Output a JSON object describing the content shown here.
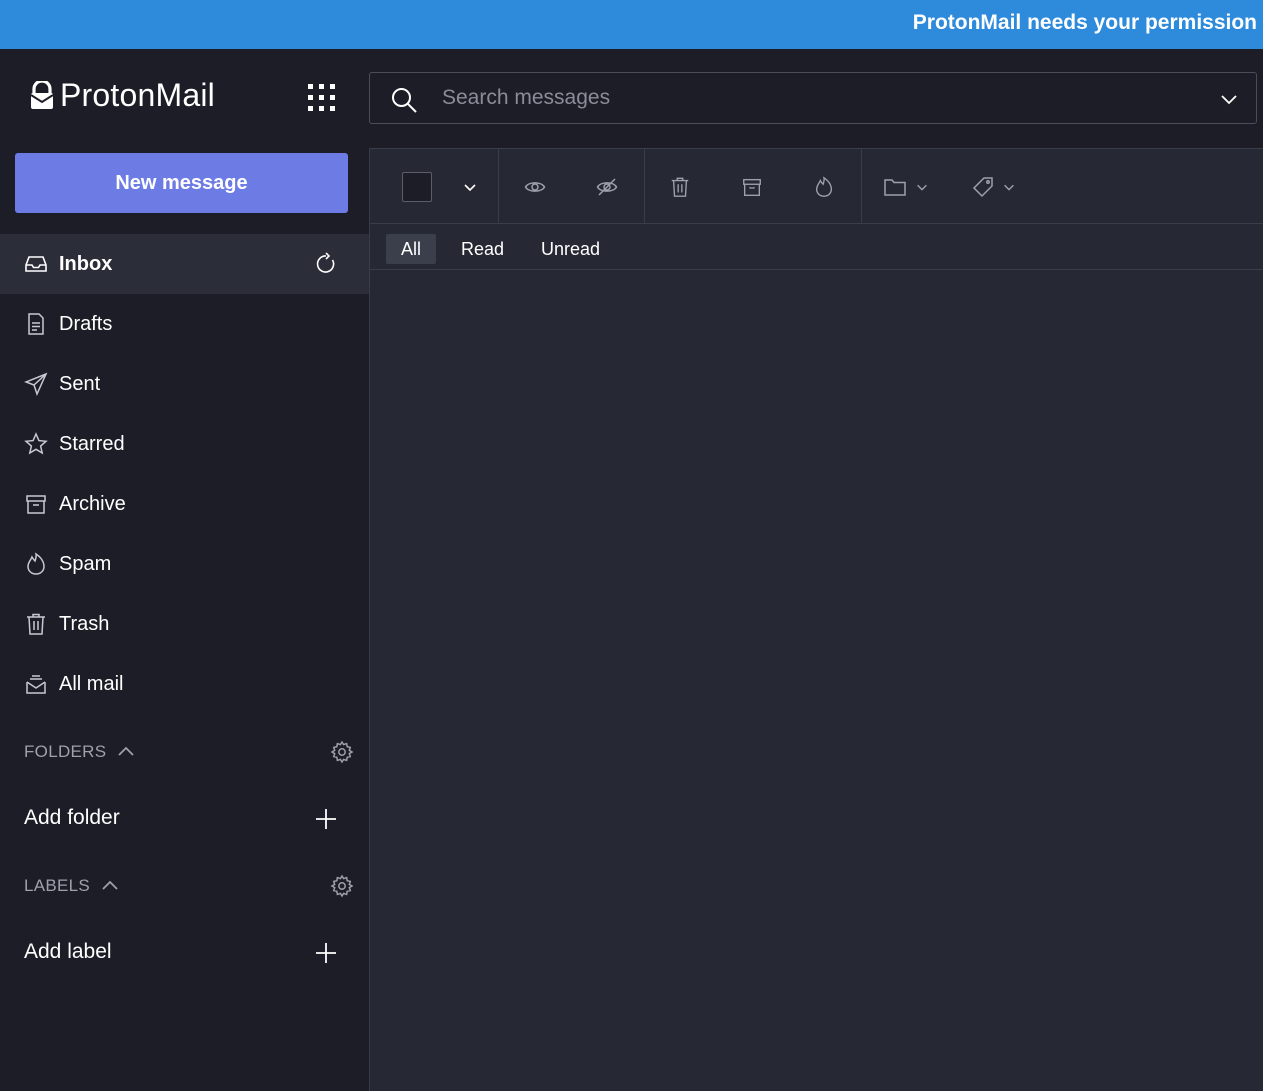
{
  "banner": {
    "text": "ProtonMail needs your permission"
  },
  "app": {
    "name": "ProtonMail"
  },
  "compose": {
    "label": "New message"
  },
  "nav": {
    "items": [
      {
        "id": "inbox",
        "label": "Inbox",
        "icon": "inbox-icon",
        "active": true
      },
      {
        "id": "drafts",
        "label": "Drafts",
        "icon": "drafts-icon"
      },
      {
        "id": "sent",
        "label": "Sent",
        "icon": "sent-icon"
      },
      {
        "id": "starred",
        "label": "Starred",
        "icon": "star-icon"
      },
      {
        "id": "archive",
        "label": "Archive",
        "icon": "archive-icon"
      },
      {
        "id": "spam",
        "label": "Spam",
        "icon": "spam-icon"
      },
      {
        "id": "trash",
        "label": "Trash",
        "icon": "trash-icon"
      },
      {
        "id": "allmail",
        "label": "All mail",
        "icon": "all-mail-icon"
      }
    ]
  },
  "folders": {
    "title": "FOLDERS",
    "add_label": "Add folder"
  },
  "labels": {
    "title": "LABELS",
    "add_label": "Add label"
  },
  "search": {
    "placeholder": "Search messages",
    "value": ""
  },
  "filters": {
    "all": "All",
    "read": "Read",
    "unread": "Unread",
    "selected": "All"
  },
  "colors": {
    "banner": "#2e8bdc",
    "accent": "#6d7ce4",
    "sidebar_bg": "#1c1d26",
    "content_bg": "#262933",
    "active_item_bg": "#2b2d38"
  }
}
